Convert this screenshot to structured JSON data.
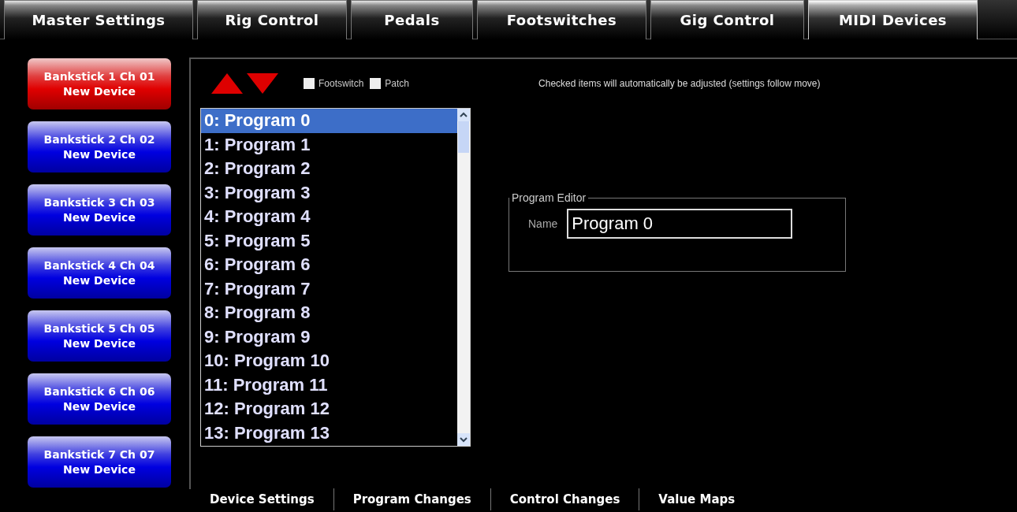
{
  "top_tabs": [
    {
      "label": "Master Settings",
      "selected": false
    },
    {
      "label": "Rig Control",
      "selected": false
    },
    {
      "label": "Pedals",
      "selected": false
    },
    {
      "label": "Footswitches",
      "selected": false
    },
    {
      "label": "Gig Control",
      "selected": false
    },
    {
      "label": "MIDI Devices",
      "selected": true
    }
  ],
  "devices": [
    {
      "line1": "Bankstick 1 Ch 01",
      "line2": "New Device",
      "selected": true
    },
    {
      "line1": "Bankstick 2 Ch 02",
      "line2": "New Device",
      "selected": false
    },
    {
      "line1": "Bankstick 3 Ch 03",
      "line2": "New Device",
      "selected": false
    },
    {
      "line1": "Bankstick 4 Ch 04",
      "line2": "New Device",
      "selected": false
    },
    {
      "line1": "Bankstick 5 Ch 05",
      "line2": "New Device",
      "selected": false
    },
    {
      "line1": "Bankstick 6 Ch 06",
      "line2": "New Device",
      "selected": false
    },
    {
      "line1": "Bankstick 7 Ch 07",
      "line2": "New Device",
      "selected": false
    }
  ],
  "move_options": [
    {
      "label": "Footswitch",
      "checked": false
    },
    {
      "label": "Patch",
      "checked": false
    }
  ],
  "note": "Checked items will automatically be adjusted (settings follow move)",
  "programs": [
    {
      "label": "0: Program 0",
      "selected": true
    },
    {
      "label": "1: Program 1",
      "selected": false
    },
    {
      "label": "2: Program 2",
      "selected": false
    },
    {
      "label": "3: Program 3",
      "selected": false
    },
    {
      "label": "4: Program 4",
      "selected": false
    },
    {
      "label": "5: Program 5",
      "selected": false
    },
    {
      "label": "6: Program 6",
      "selected": false
    },
    {
      "label": "7: Program 7",
      "selected": false
    },
    {
      "label": "8: Program 8",
      "selected": false
    },
    {
      "label": "9: Program 9",
      "selected": false
    },
    {
      "label": "10: Program 10",
      "selected": false
    },
    {
      "label": "11: Program 11",
      "selected": false
    },
    {
      "label": "12: Program 12",
      "selected": false
    },
    {
      "label": "13: Program 13",
      "selected": false
    }
  ],
  "program_editor": {
    "title": "Program Editor",
    "name_label": "Name",
    "name_value": "Program 0"
  },
  "bottom_tabs": [
    "Device Settings",
    "Program Changes",
    "Control Changes",
    "Value Maps"
  ]
}
